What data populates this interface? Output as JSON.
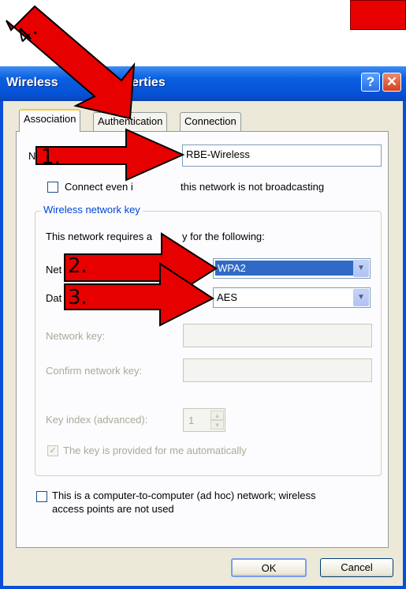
{
  "window": {
    "title": "Wireless network properties",
    "title_visible": "Wireless          k properties",
    "help_glyph": "?",
    "close_glyph": "✕"
  },
  "tabs": [
    {
      "label": "Association",
      "active": true
    },
    {
      "label": "Authentication",
      "active": false
    },
    {
      "label": "Connection",
      "active": false
    }
  ],
  "ssid": {
    "label_visible": "N",
    "value": "RBE-Wireless"
  },
  "connect_hidden": {
    "label": "Connect even if this network is not broadcasting",
    "label_left": "Connect even i",
    "label_right": "this network is not broadcasting",
    "checked": false
  },
  "key_group": {
    "title": "Wireless network key",
    "requires_text_left": "This network requires a ",
    "requires_text_right": "y for the following:",
    "network_auth": {
      "label_visible": "Net",
      "value": "WPA2",
      "arrow_glyph": "▼"
    },
    "data_encryption": {
      "label_visible": "Dat",
      "value": "AES",
      "arrow_glyph": "▼"
    },
    "network_key": {
      "label": "Network key:",
      "value": ""
    },
    "confirm_key": {
      "label": "Confirm network key:",
      "value": ""
    },
    "key_index": {
      "label": "Key index (advanced):",
      "value": "1"
    },
    "auto_key": {
      "label": "The key is provided for me automatically",
      "checked": true,
      "check_glyph": "✓"
    }
  },
  "adhoc": {
    "line1": "This is a computer-to-computer (ad hoc) network; wireless",
    "line2": "access points are not used",
    "checked": false
  },
  "buttons": {
    "ok": "OK",
    "cancel": "Cancel"
  },
  "annotations": {
    "color": "#e60000",
    "labels": [
      "1.",
      "2.",
      "3.",
      "4."
    ]
  }
}
